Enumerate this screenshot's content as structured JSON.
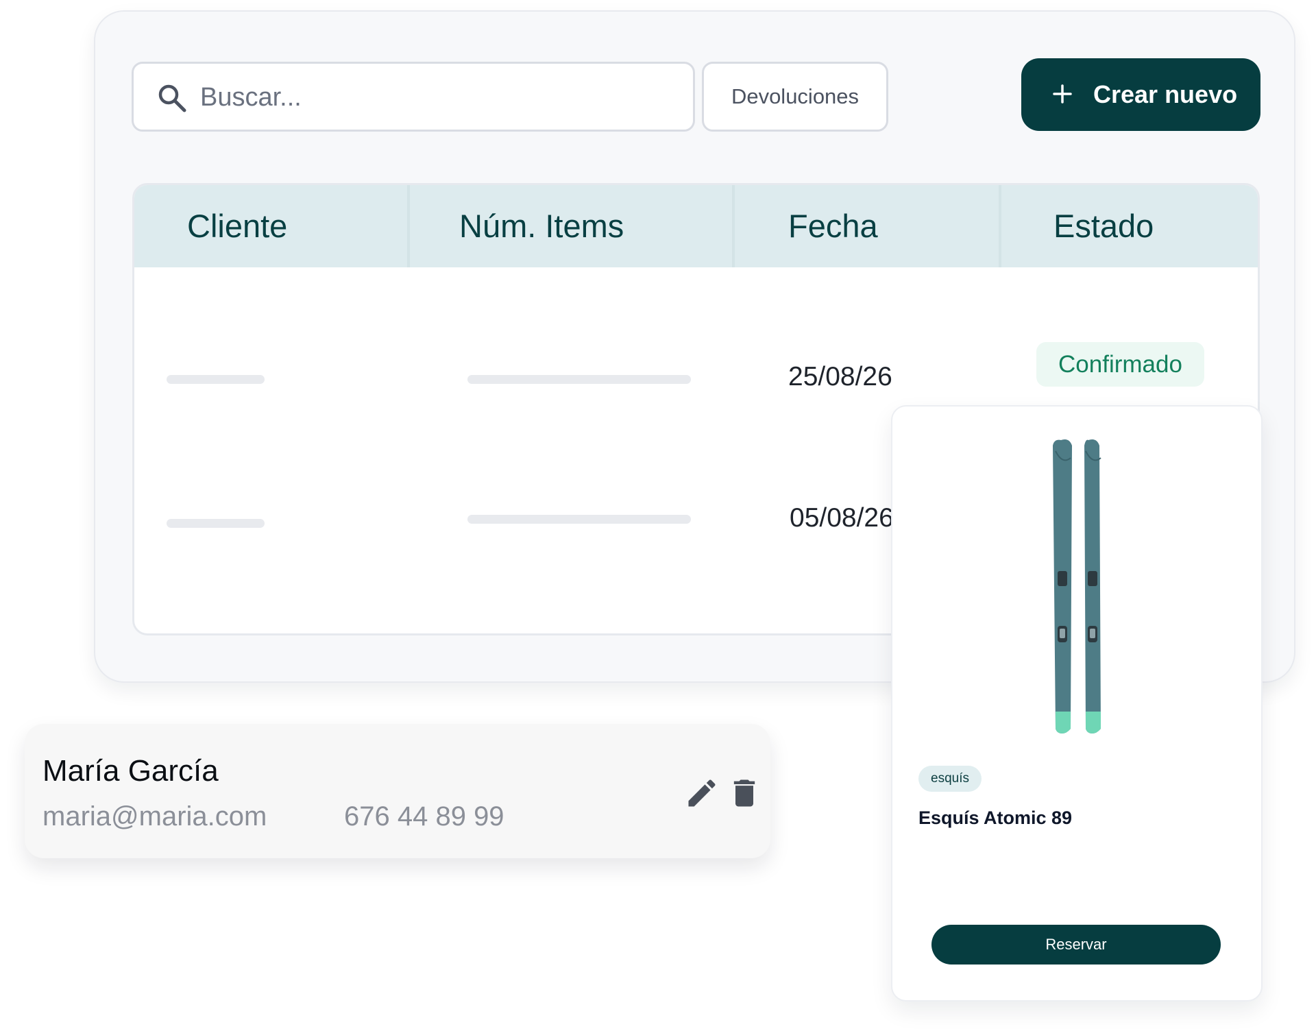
{
  "toolbar": {
    "search_placeholder": "Buscar...",
    "filter_label": "Devoluciones",
    "create_label": "Crear nuevo"
  },
  "table": {
    "columns": [
      "Cliente",
      "Núm. Items",
      "Fecha",
      "Estado"
    ],
    "rows": [
      {
        "fecha": "25/08/26",
        "estado": "Confirmado"
      },
      {
        "fecha": "05/08/26",
        "estado": ""
      }
    ]
  },
  "contact": {
    "name": "María García",
    "email": "maria@maria.com",
    "phone": "676 44 89 99"
  },
  "product": {
    "tag": "esquís",
    "name": "Esquís Atomic 89",
    "button": "Reservar"
  },
  "colors": {
    "brand": "#063d40",
    "table_header_bg": "#ddebee",
    "confirmed_text": "#13805c",
    "confirmed_bg": "#ecf8f3"
  },
  "icons": [
    "search-icon",
    "plus-icon",
    "edit-icon",
    "trash-icon"
  ]
}
